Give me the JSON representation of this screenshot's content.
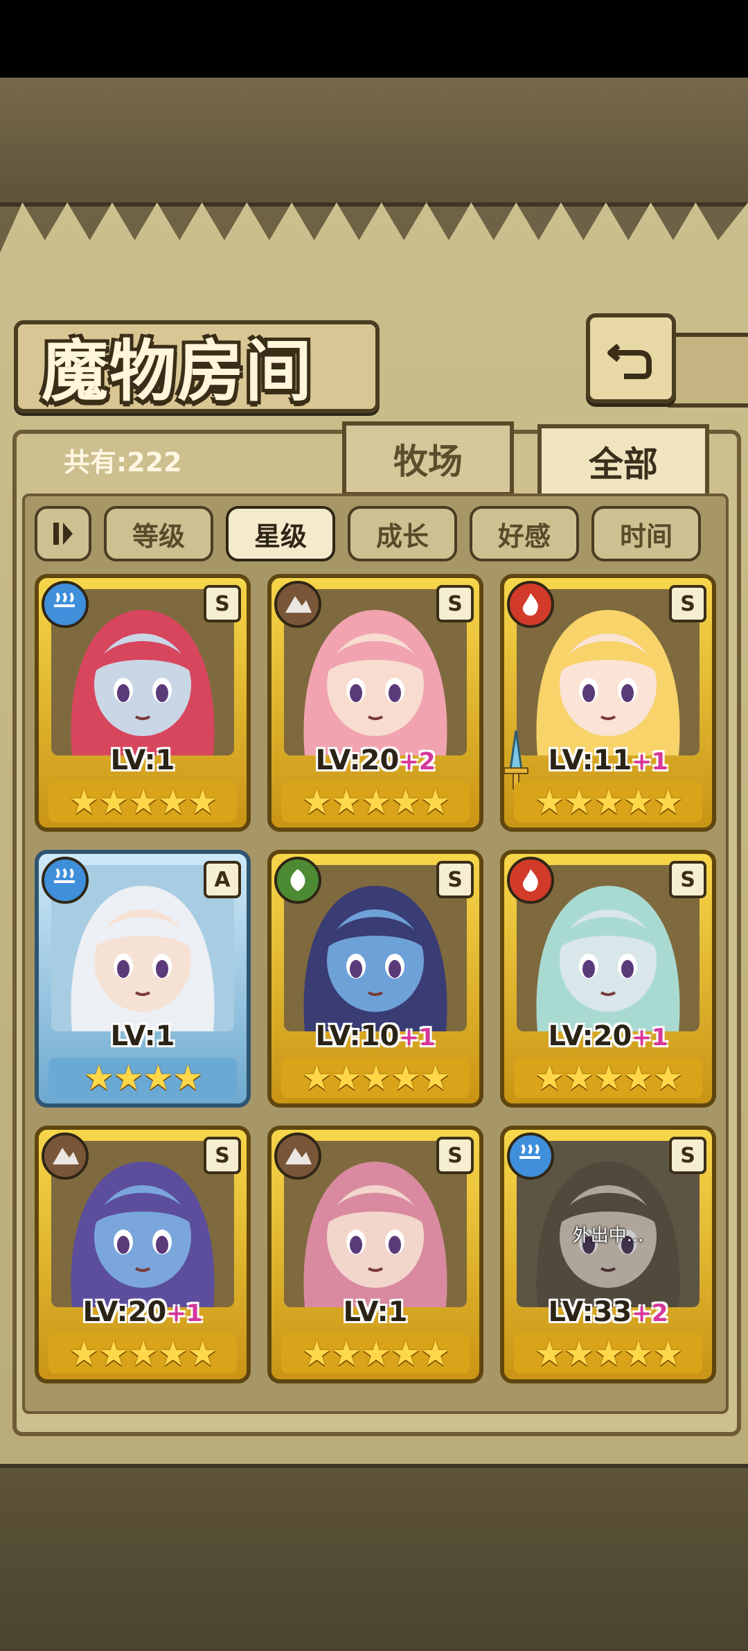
{
  "header": {
    "title": "魔物房间",
    "back_icon": "return-arrow-icon"
  },
  "summary": {
    "count_text": "共有:222"
  },
  "tabs": [
    {
      "label": "牧场",
      "active": false
    },
    {
      "label": "全部",
      "active": true
    }
  ],
  "sort": {
    "order_toggle_icon": "order-toggle-icon",
    "options": [
      {
        "label": "等级",
        "active": false
      },
      {
        "label": "星级",
        "active": true
      },
      {
        "label": "成长",
        "active": false
      },
      {
        "label": "好感",
        "active": false
      },
      {
        "label": "时间",
        "active": false
      }
    ]
  },
  "monsters": [
    {
      "element": "water",
      "rank": "S",
      "level": "LV:1",
      "bonus": "",
      "stars": 5,
      "hair": "#d8465e",
      "skin": "#c9d6e6",
      "status": ""
    },
    {
      "element": "earth",
      "rank": "S",
      "level": "LV:20",
      "bonus": "+2",
      "stars": 5,
      "hair": "#f1a3b0",
      "skin": "#f7dccf",
      "status": ""
    },
    {
      "element": "fire",
      "rank": "S",
      "level": "LV:11",
      "bonus": "+1",
      "stars": 5,
      "hair": "#f7d36a",
      "skin": "#fbe3d6",
      "status": "",
      "equipped_icon": "sword-icon"
    },
    {
      "element": "water",
      "rank": "A",
      "level": "LV:1",
      "bonus": "",
      "stars": 4,
      "hair": "#eceff3",
      "skin": "#f6e2d5",
      "status": ""
    },
    {
      "element": "wood",
      "rank": "S",
      "level": "LV:10",
      "bonus": "+1",
      "stars": 5,
      "hair": "#3a3c74",
      "skin": "#6ea1d8",
      "status": ""
    },
    {
      "element": "fire",
      "rank": "S",
      "level": "LV:20",
      "bonus": "+1",
      "stars": 5,
      "hair": "#a9dad1",
      "skin": "#d9e6ea",
      "status": ""
    },
    {
      "element": "earth",
      "rank": "S",
      "level": "LV:20",
      "bonus": "+1",
      "stars": 5,
      "hair": "#5c4e9d",
      "skin": "#7aa6dc",
      "status": ""
    },
    {
      "element": "earth",
      "rank": "S",
      "level": "LV:1",
      "bonus": "",
      "stars": 5,
      "hair": "#d98aa0",
      "skin": "#f2d6cb",
      "status": ""
    },
    {
      "element": "water",
      "rank": "S",
      "level": "LV:33",
      "bonus": "+2",
      "stars": 5,
      "hair": "#6d5a3a",
      "skin": "#e6cdb0",
      "status": "外出中..."
    }
  ],
  "colors": {
    "water": "#3f8fdb",
    "earth": "#7a5638",
    "fire": "#d23a2a",
    "wood": "#4c8a34"
  }
}
